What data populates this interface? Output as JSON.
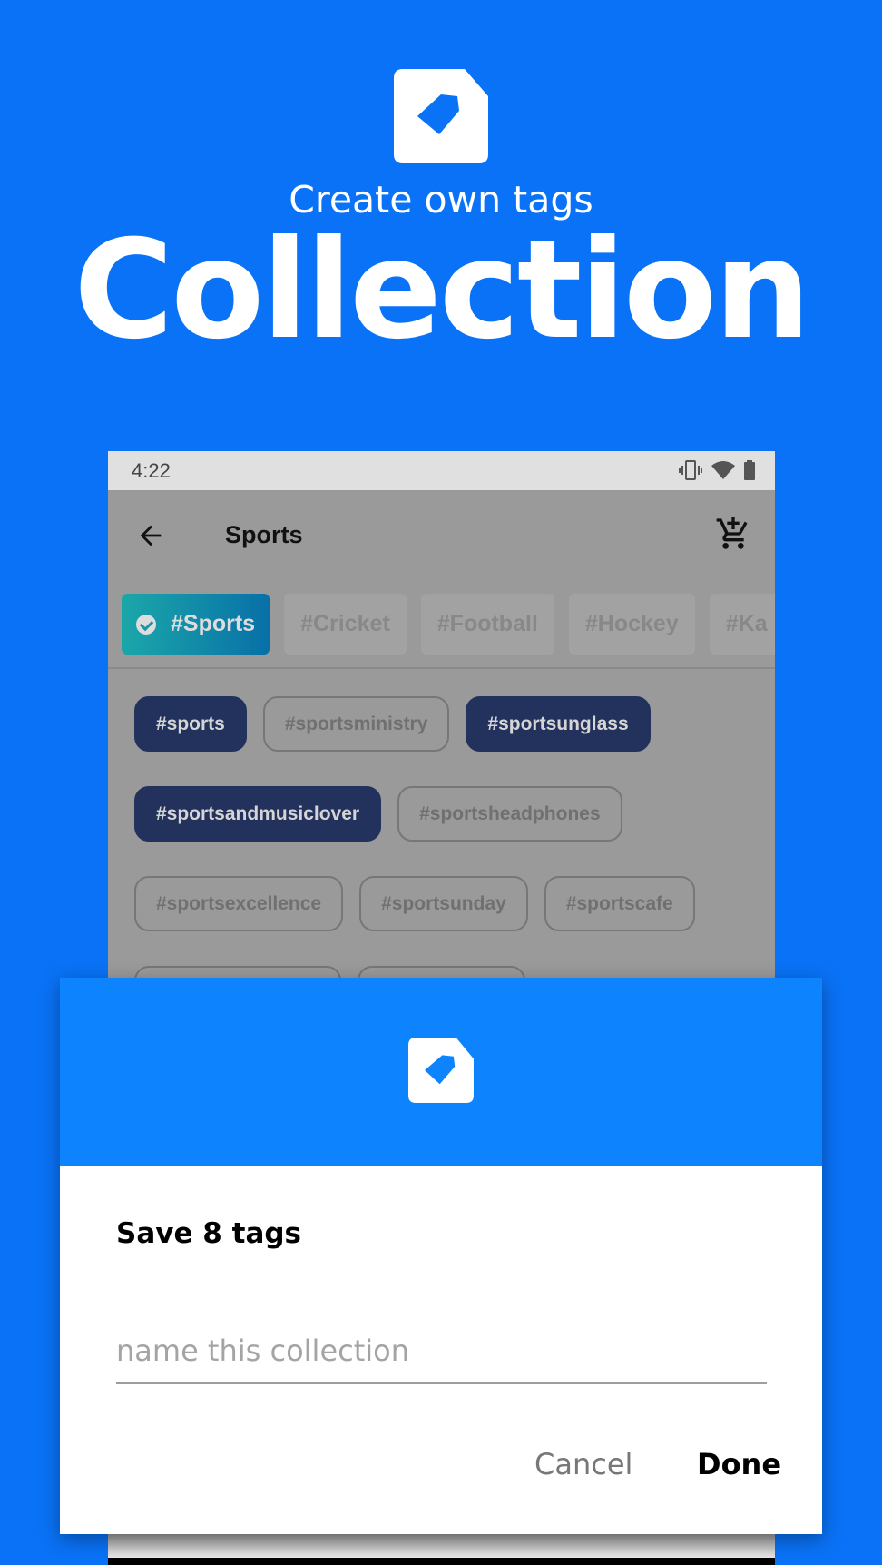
{
  "hero": {
    "icon": "tag-file-icon",
    "subtitle": "Create own tags",
    "title": "Collection"
  },
  "colors": {
    "background": "#0a72f6",
    "dialog_header": "#0d83fe",
    "selected_tag": "#22325c"
  },
  "screen": {
    "status": {
      "time": "4:22",
      "icons": [
        "vibrate-icon",
        "wifi-icon",
        "battery-icon"
      ]
    },
    "appbar": {
      "title": "Sports",
      "back_icon": "arrow-left-icon",
      "action_icon": "add-to-cart-icon"
    },
    "categories": [
      {
        "label": "#Sports",
        "selected": true
      },
      {
        "label": "#Cricket"
      },
      {
        "label": "#Football"
      },
      {
        "label": "#Hockey"
      },
      {
        "label": "#Ka"
      }
    ],
    "tags": [
      {
        "label": "#sports",
        "selected": true
      },
      {
        "label": "#sportsministry"
      },
      {
        "label": "#sportsunglass",
        "selected": true
      },
      {
        "label": "#sportsandmusiclover",
        "selected": true
      },
      {
        "label": "#sportsheadphones"
      },
      {
        "label": "#sportsexcellence"
      },
      {
        "label": "#sportsunday"
      },
      {
        "label": "#sportscafe"
      }
    ]
  },
  "dialog": {
    "icon": "tag-file-icon",
    "title": "Save 8 tags",
    "input_placeholder": "name this collection",
    "input_value": "",
    "cancel_label": "Cancel",
    "done_label": "Done"
  }
}
